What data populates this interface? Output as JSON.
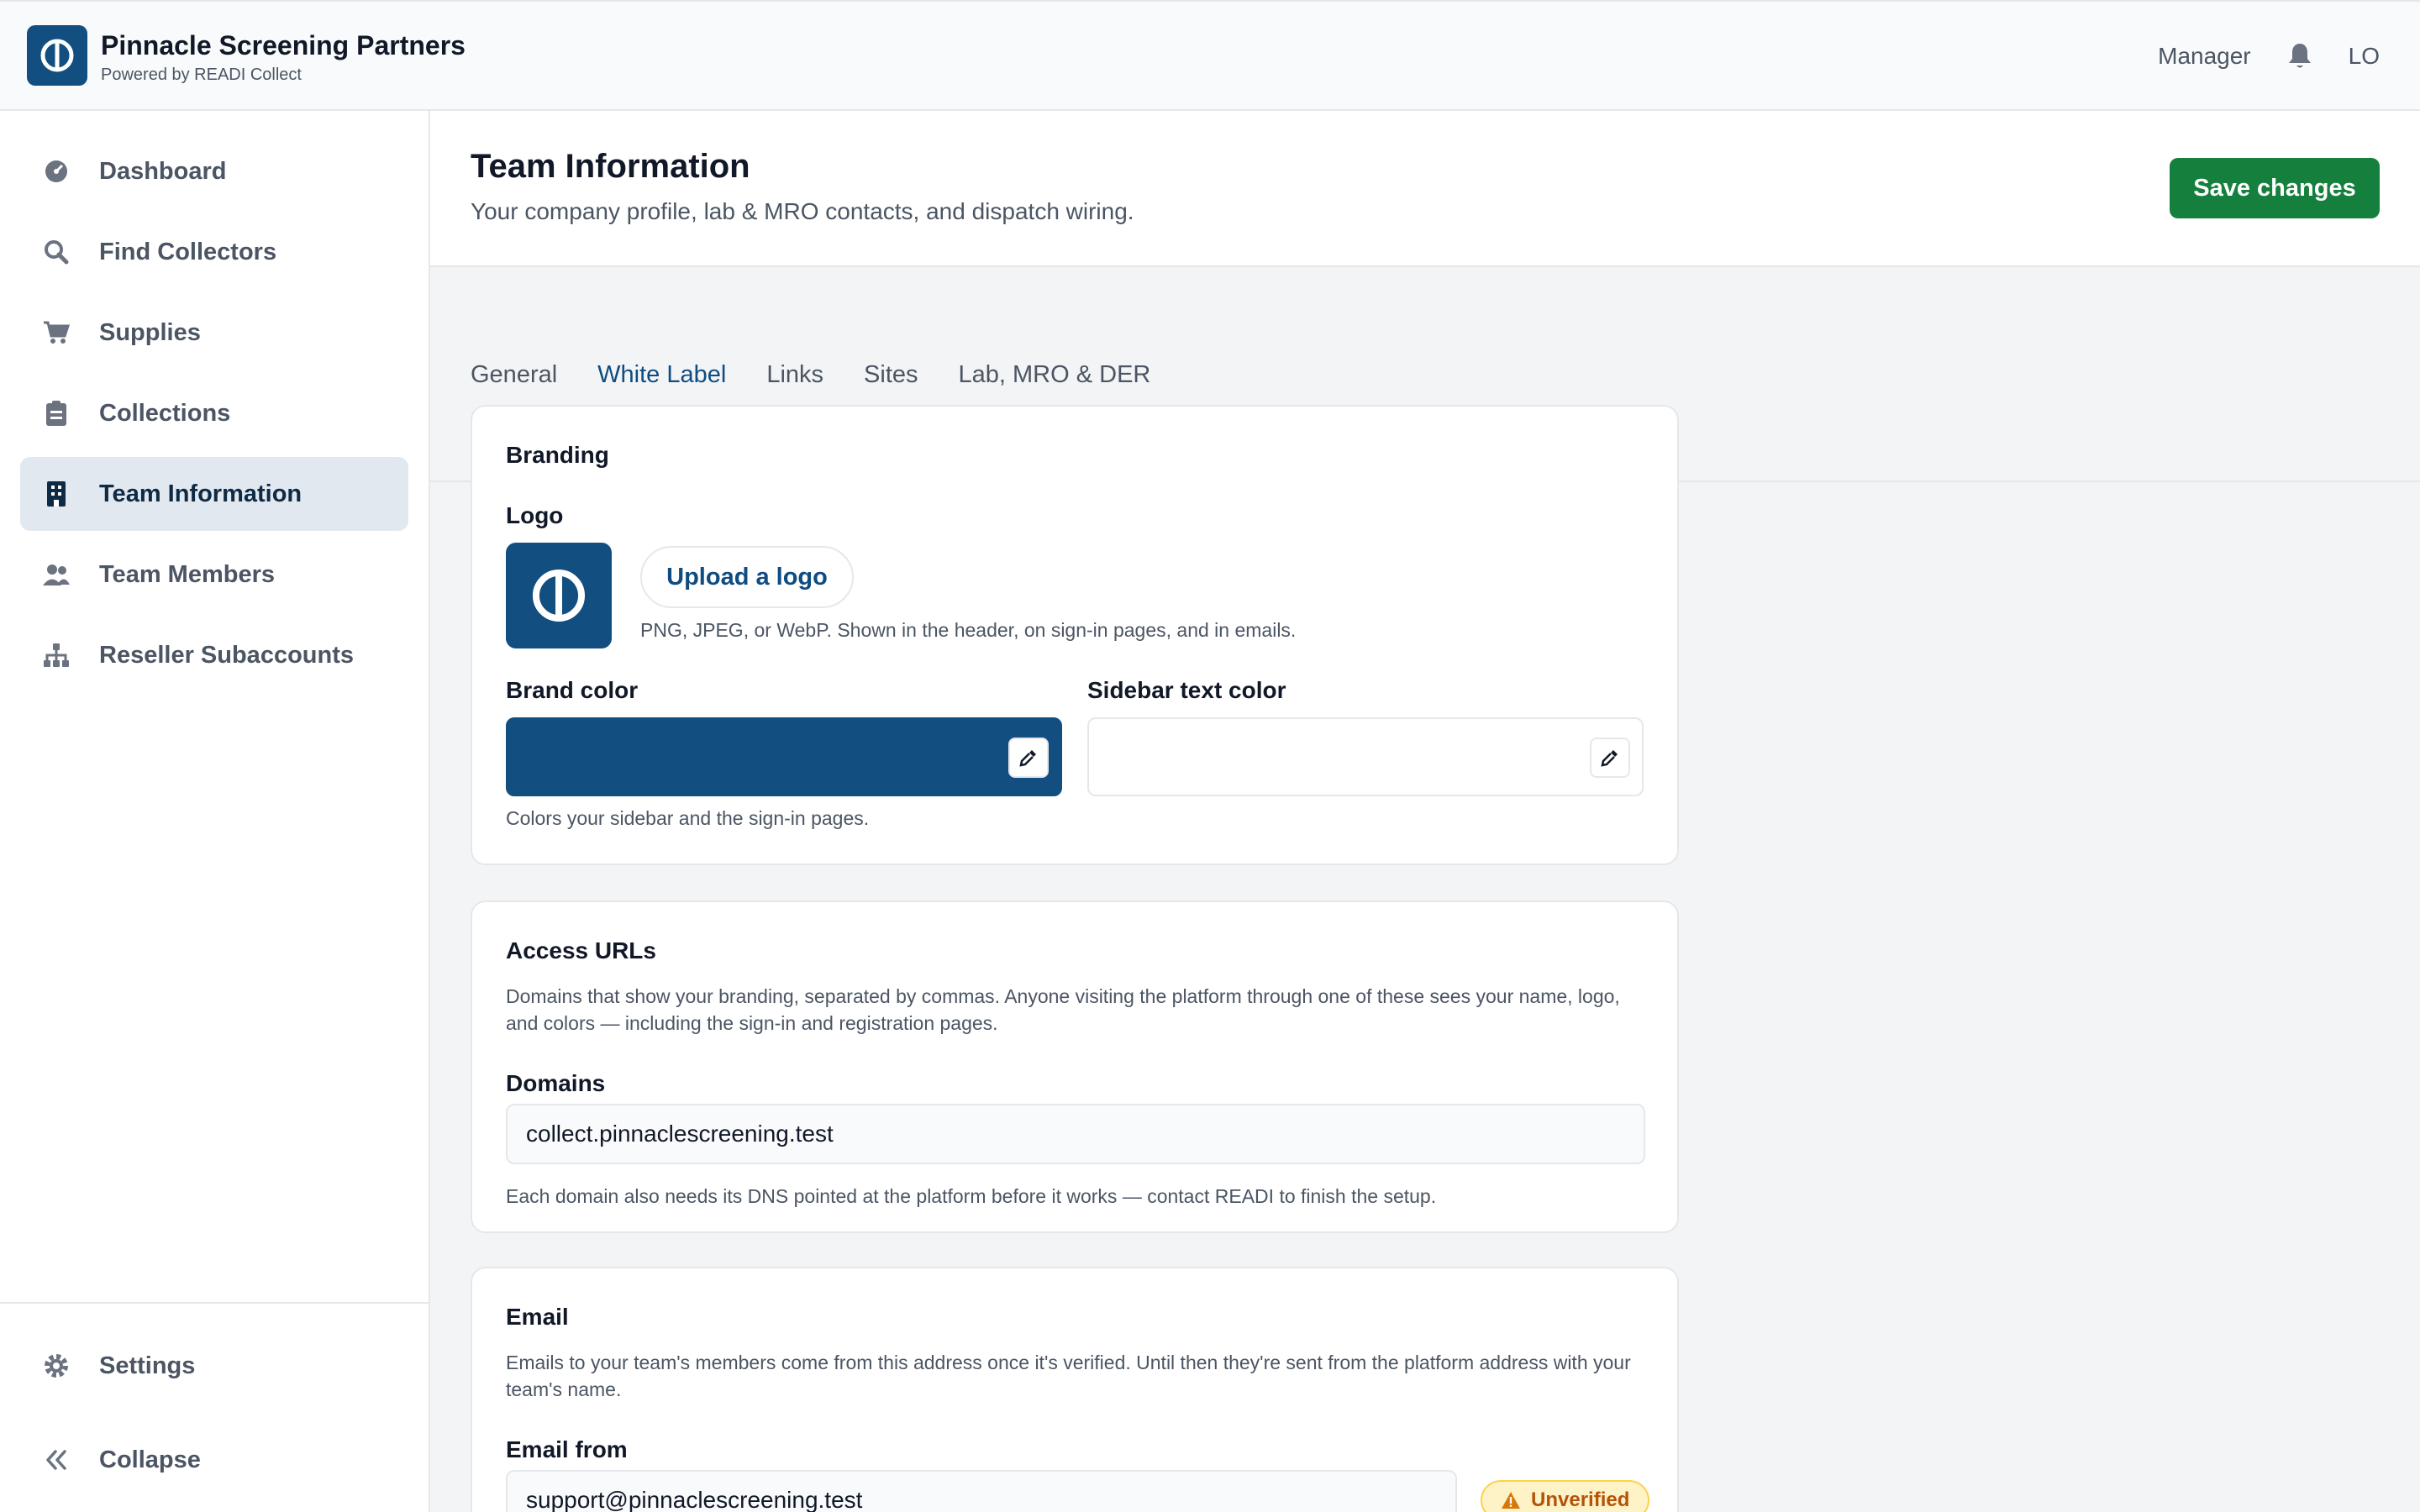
{
  "header": {
    "company_name": "Pinnacle Screening Partners",
    "powered_by": "Powered by READI Collect",
    "role": "Manager",
    "avatar_initials": "LO"
  },
  "sidebar": {
    "items": [
      {
        "label": "Dashboard",
        "icon": "dashboard-icon"
      },
      {
        "label": "Find Collectors",
        "icon": "search-icon"
      },
      {
        "label": "Supplies",
        "icon": "cart-icon"
      },
      {
        "label": "Collections",
        "icon": "clipboard-icon"
      },
      {
        "label": "Team Information",
        "icon": "building-icon",
        "active": true
      },
      {
        "label": "Team Members",
        "icon": "users-icon"
      },
      {
        "label": "Reseller Subaccounts",
        "icon": "hierarchy-icon"
      }
    ],
    "settings_label": "Settings",
    "collapse_label": "Collapse"
  },
  "page": {
    "title": "Team Information",
    "subtitle": "Your company profile, lab & MRO contacts, and dispatch wiring.",
    "save_label": "Save changes"
  },
  "tabs": [
    {
      "label": "General"
    },
    {
      "label": "White Label",
      "active": true
    },
    {
      "label": "Links"
    },
    {
      "label": "Sites"
    },
    {
      "label": "Lab, MRO & DER"
    }
  ],
  "branding": {
    "title": "Branding",
    "logo_label": "Logo",
    "upload_label": "Upload a logo",
    "logo_help": "PNG, JPEG, or WebP. Shown in the header, on sign-in pages, and in emails.",
    "brand_color_label": "Brand color",
    "brand_color_value": "#124e80",
    "sidebar_text_color_label": "Sidebar text color",
    "sidebar_text_color_value": "#ffffff",
    "color_help": "Colors your sidebar and the sign-in pages."
  },
  "access_urls": {
    "title": "Access URLs",
    "description": "Domains that show your branding, separated by commas. Anyone visiting the platform through one of these sees your name, logo, and colors — including the sign-in and registration pages.",
    "domains_label": "Domains",
    "domains_value": "collect.pinnaclescreening.test",
    "dns_help": "Each domain also needs its DNS pointed at the platform before it works — contact READI to finish the setup."
  },
  "email": {
    "title": "Email",
    "description": "Emails to your team's members come from this address once it's verified. Until then they're sent from the platform address with your team's name.",
    "email_from_label": "Email from",
    "email_from_value": "support@pinnaclescreening.test",
    "status_badge": "Unverified"
  },
  "colors": {
    "brand": "#124e80",
    "save_green": "#15803d",
    "active_tab": "#0f4c81",
    "warning": "#b45309"
  }
}
